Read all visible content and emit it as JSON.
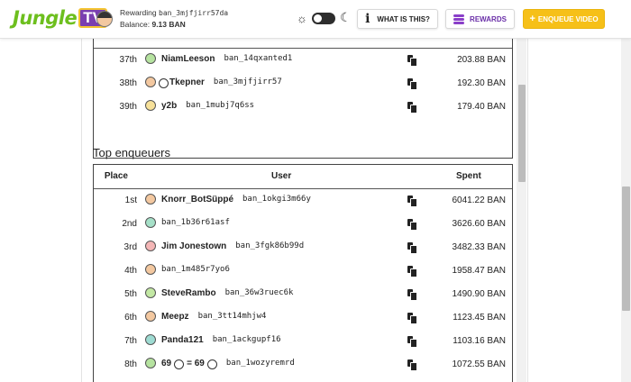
{
  "header": {
    "logo_text": "Jungle",
    "logo_tv": "TV",
    "rewarding_label": "Rewarding",
    "rewarding_address": "ban_3mjfjirr57da",
    "balance_label": "Balance:",
    "balance_value": "9.13 BAN",
    "what_is_this": "WHAT IS THIS?",
    "rewards": "REWARDS",
    "enqueue": "ENQUEUE VIDEO"
  },
  "top_rows": [
    {
      "place": "37th",
      "name": "NiamLeeson",
      "address": "ban_14qxanted1",
      "spent": "203.88 BAN",
      "avatar_color": "#b6e3a0"
    },
    {
      "place": "38th",
      "name": "Tkepner",
      "address": "ban_3mjfjirr57",
      "spent": "192.30 BAN",
      "avatar_color": "#f3c8a0"
    },
    {
      "place": "39th",
      "name": "y2b",
      "address": "ban_1mubj7q6ss",
      "spent": "179.40 BAN",
      "avatar_color": "#f7e19a"
    }
  ],
  "enqueuers": {
    "title": "Top enqueuers",
    "columns": {
      "place": "Place",
      "user": "User",
      "spent": "Spent"
    },
    "rows": [
      {
        "place": "1st",
        "name": "Knorr_BotSüppé",
        "address": "ban_1okgi3m66y",
        "spent": "6041.22 BAN",
        "avatar_color": "#f3c8a0"
      },
      {
        "place": "2nd",
        "name": "",
        "address": "ban_1b36r61asf",
        "spent": "3626.60 BAN",
        "avatar_color": "#a6e0c8"
      },
      {
        "place": "3rd",
        "name": "Jim Jonestown",
        "address": "ban_3fgk86b99d",
        "spent": "3482.33 BAN",
        "avatar_color": "#f4b6b6"
      },
      {
        "place": "4th",
        "name": "",
        "address": "ban_1m485r7yo6",
        "spent": "1958.47 BAN",
        "avatar_color": "#f3c8a0"
      },
      {
        "place": "5th",
        "name": "SteveRambo",
        "address": "ban_36w3ruec6k",
        "spent": "1490.90 BAN",
        "avatar_color": "#c3e8a4"
      },
      {
        "place": "6th",
        "name": "Meepz",
        "address": "ban_3tt14mhjw4",
        "spent": "1123.45 BAN",
        "avatar_color": "#f3c8a0"
      },
      {
        "place": "7th",
        "name": "Panda121",
        "address": "ban_1ackgupf16",
        "spent": "1103.16 BAN",
        "avatar_color": "#9edbd2"
      },
      {
        "place": "8th",
        "name": "69 = 69",
        "name_a": "69",
        "name_b": "= 69",
        "address": "ban_1wozyremrd",
        "spent": "1072.55 BAN",
        "avatar_color": "#b6e3a0"
      }
    ]
  }
}
